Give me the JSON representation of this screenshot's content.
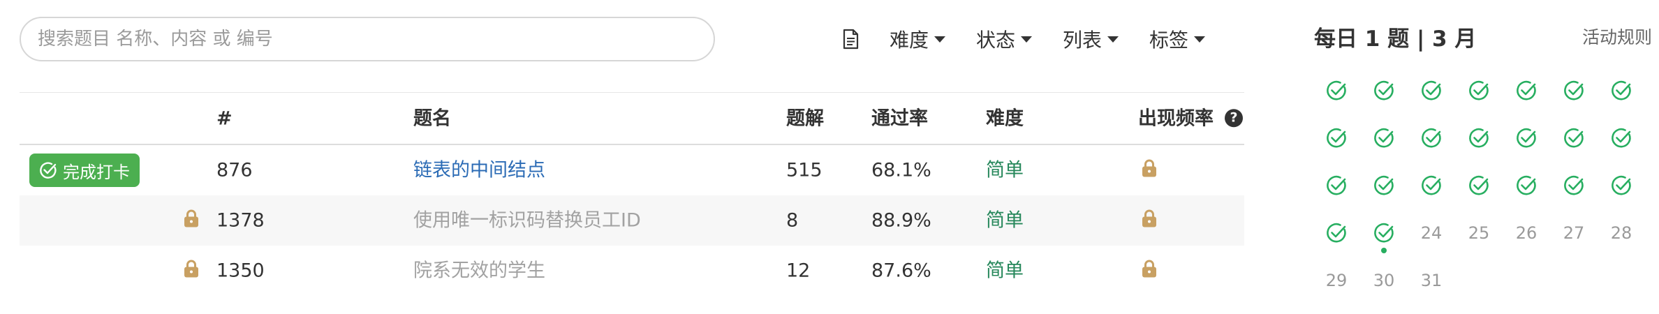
{
  "search": {
    "placeholder": "搜索题目 名称、内容 或 编号",
    "value": ""
  },
  "filters": [
    {
      "key": "difficulty",
      "label": "难度"
    },
    {
      "key": "status",
      "label": "状态"
    },
    {
      "key": "list",
      "label": "列表"
    },
    {
      "key": "tags",
      "label": "标签"
    }
  ],
  "table": {
    "headers": {
      "number": "#",
      "title": "题名",
      "solutions": "题解",
      "acceptance": "通过率",
      "difficulty": "难度",
      "frequency": "出现频率"
    },
    "rows": [
      {
        "number": "876",
        "title": "链表的中间结点",
        "solutions": "515",
        "acceptance": "68.1%",
        "difficulty": "简单",
        "badge": "完成打卡",
        "locked": false
      },
      {
        "number": "1378",
        "title": "使用唯一标识码替换员工ID",
        "solutions": "8",
        "acceptance": "88.9%",
        "difficulty": "简单",
        "locked": true
      },
      {
        "number": "1350",
        "title": "院系无效的学生",
        "solutions": "12",
        "acceptance": "87.6%",
        "difficulty": "简单",
        "locked": true
      }
    ]
  },
  "calendar": {
    "title": "每日 1 题 | 3 月",
    "rules_label": "活动规则",
    "completed_days": [
      1,
      2,
      3,
      4,
      5,
      6,
      7,
      8,
      9,
      10,
      11,
      12,
      13,
      14,
      15,
      16,
      17,
      18,
      19,
      20,
      21,
      22,
      23
    ],
    "today": 23,
    "days": [
      {
        "day": "1"
      },
      {
        "day": "2"
      },
      {
        "day": "3"
      },
      {
        "day": "4"
      },
      {
        "day": "5"
      },
      {
        "day": "6"
      },
      {
        "day": "7"
      },
      {
        "day": "8"
      },
      {
        "day": "9"
      },
      {
        "day": "10"
      },
      {
        "day": "11"
      },
      {
        "day": "12"
      },
      {
        "day": "13"
      },
      {
        "day": "14"
      },
      {
        "day": "15"
      },
      {
        "day": "16"
      },
      {
        "day": "17"
      },
      {
        "day": "18"
      },
      {
        "day": "19"
      },
      {
        "day": "20"
      },
      {
        "day": "21"
      },
      {
        "day": "22"
      },
      {
        "day": "23"
      },
      {
        "day": "24"
      },
      {
        "day": "25"
      },
      {
        "day": "26"
      },
      {
        "day": "27"
      },
      {
        "day": "28"
      },
      {
        "day": "29"
      },
      {
        "day": "30"
      },
      {
        "day": "31"
      }
    ]
  },
  "colors": {
    "success": "#4caf50",
    "check": "#27ae60",
    "link": "#2b6bb5",
    "easy": "#25875a",
    "lock": "#c8a062"
  }
}
